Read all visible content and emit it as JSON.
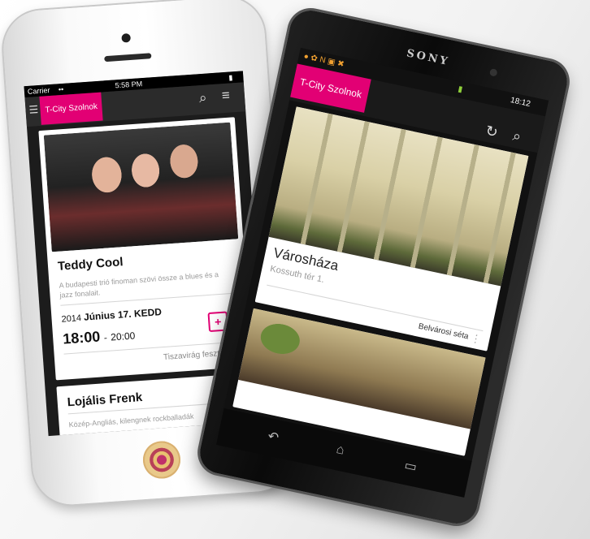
{
  "iphone": {
    "status": {
      "carrier": "Carrier",
      "wifi": "••",
      "time": "5:58 PM",
      "battery": "▮"
    },
    "nav": {
      "menu_icon": "☰",
      "brand": "T-City Szolnok",
      "search_icon": "⌕",
      "list_icon": "≡"
    },
    "event": {
      "title": "Teddy Cool",
      "description": "A budapesti trió finoman szövi össze a blues és a jazz fonalait.",
      "year": "2014",
      "date": "Június 17. KEDD",
      "start_time": "18:00",
      "separator": "-",
      "end_time": "20:00",
      "venue": "Tiszavirág fesztivál",
      "calendar_icon": "calendar-add-icon"
    },
    "next_event": {
      "title": "Lojális Frenk",
      "description": "Közép-Angliás, kilengnek rockballadák"
    }
  },
  "sony": {
    "brand": "SONY",
    "status": {
      "time": "18:12"
    },
    "nav": {
      "brand": "T-City Szolnok",
      "refresh_icon": "↻",
      "search_icon": "⌕"
    },
    "place": {
      "title": "Városháza",
      "address": "Kossuth tér 1."
    },
    "tour": {
      "label": "Belvárosi séta"
    },
    "softkeys": {
      "back": "↶",
      "home": "⌂",
      "recents": "▭"
    }
  },
  "colors": {
    "brand": "#e20074"
  }
}
